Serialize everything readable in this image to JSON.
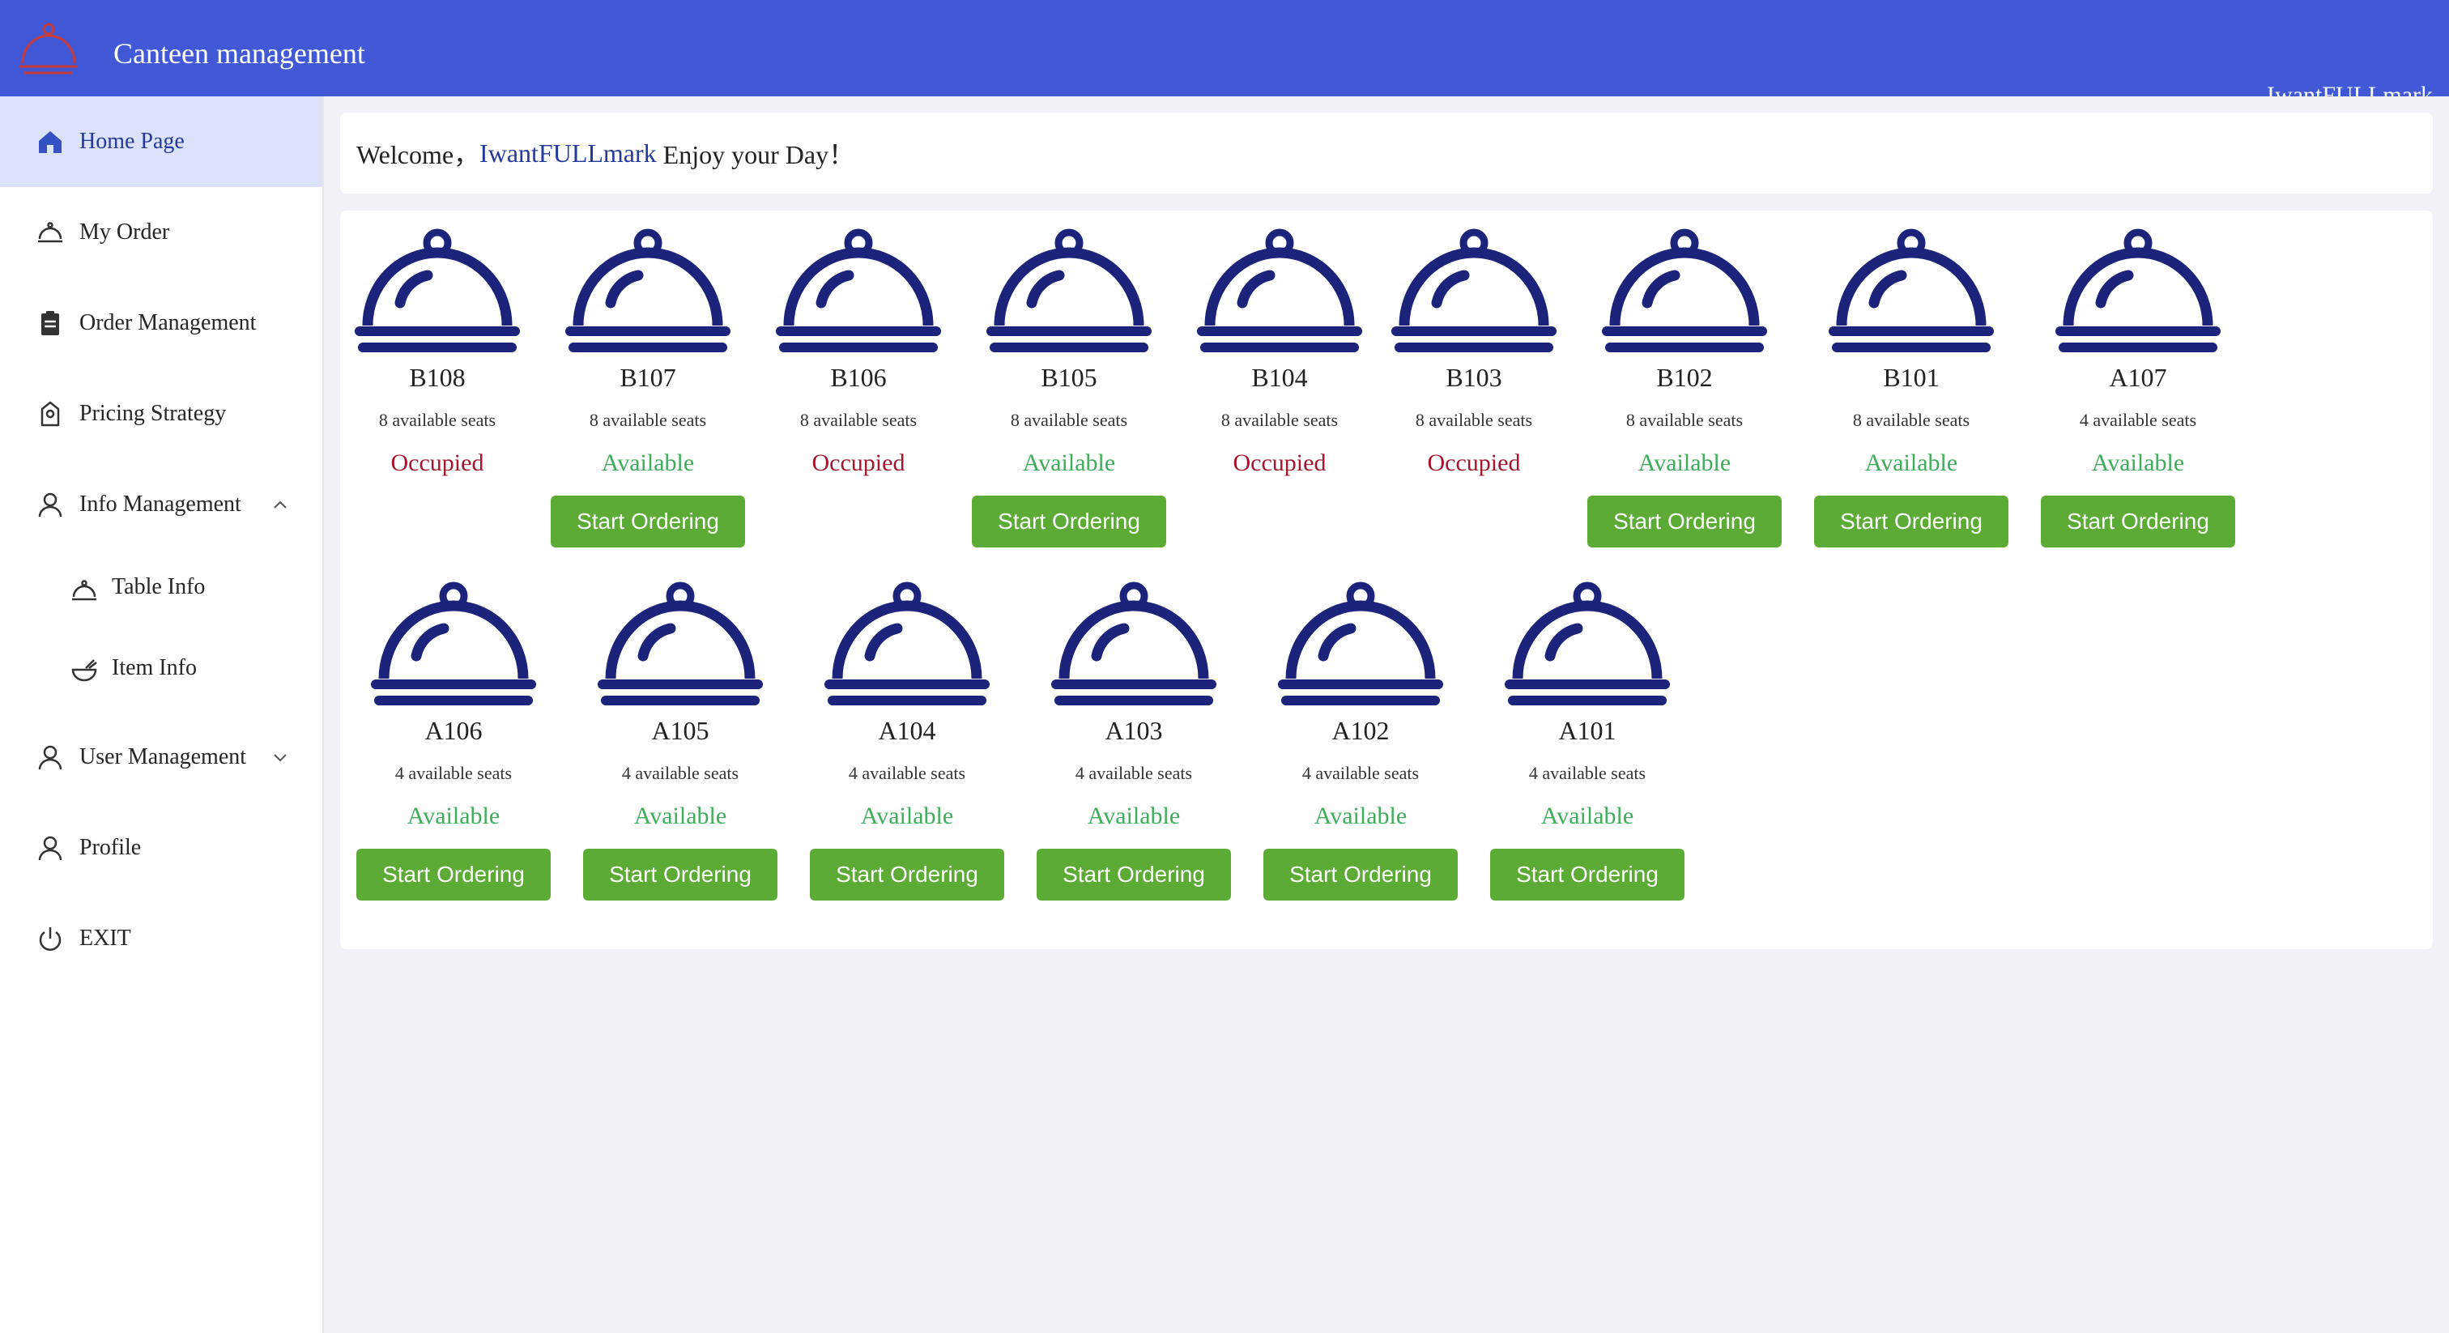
{
  "header": {
    "title": "Canteen management",
    "user": "IwantFULLmark"
  },
  "sidebar": {
    "items": [
      {
        "label": "Home Page",
        "icon": "home-icon",
        "active": true
      },
      {
        "label": "My Order",
        "icon": "cloche-icon"
      },
      {
        "label": "Order Management",
        "icon": "clipboard-icon"
      },
      {
        "label": "Pricing Strategy",
        "icon": "price-tag-icon"
      },
      {
        "label": "Info Management",
        "icon": "user-icon",
        "expanded": true
      },
      {
        "label": "User Management",
        "icon": "user-icon"
      },
      {
        "label": "Profile",
        "icon": "user-icon"
      },
      {
        "label": "EXIT",
        "icon": "power-icon"
      }
    ],
    "subitems": [
      {
        "label": "Table Info",
        "icon": "cloche-icon"
      },
      {
        "label": "Item Info",
        "icon": "bowl-icon"
      }
    ]
  },
  "welcome": {
    "prefix": "Welcome，",
    "name": "IwantFULLmark",
    "suffix": " Enjoy your Day！"
  },
  "tables": [
    {
      "name": "B108",
      "seats": "8 available seats",
      "status": "Occupied",
      "button": ""
    },
    {
      "name": "B107",
      "seats": "8 available seats",
      "status": "Available",
      "button": "Start Ordering"
    },
    {
      "name": "B106",
      "seats": "8 available seats",
      "status": "Occupied",
      "button": ""
    },
    {
      "name": "B105",
      "seats": "8 available seats",
      "status": "Available",
      "button": "Start Ordering"
    },
    {
      "name": "B104",
      "seats": "8 available seats",
      "status": "Occupied",
      "button": ""
    },
    {
      "name": "B103",
      "seats": "8 available seats",
      "status": "Occupied",
      "button": ""
    },
    {
      "name": "B102",
      "seats": "8 available seats",
      "status": "Available",
      "button": "Start Ordering"
    },
    {
      "name": "B101",
      "seats": "8 available seats",
      "status": "Available",
      "button": "Start Ordering"
    },
    {
      "name": "A107",
      "seats": "4 available seats",
      "status": "Available",
      "button": "Start Ordering"
    },
    {
      "name": "A106",
      "seats": "4 available seats",
      "status": "Available",
      "button": "Start Ordering"
    },
    {
      "name": "A105",
      "seats": "4 available seats",
      "status": "Available",
      "button": "Start Ordering"
    },
    {
      "name": "A104",
      "seats": "4 available seats",
      "status": "Available",
      "button": "Start Ordering"
    },
    {
      "name": "A103",
      "seats": "4 available seats",
      "status": "Available",
      "button": "Start Ordering"
    },
    {
      "name": "A102",
      "seats": "4 available seats",
      "status": "Available",
      "button": "Start Ordering"
    },
    {
      "name": "A101",
      "seats": "4 available seats",
      "status": "Available",
      "button": "Start Ordering"
    }
  ],
  "colors": {
    "header": "#4159d6",
    "active_nav": "#dbe2fa",
    "available": "#3dae5a",
    "occupied": "#a3162e",
    "button": "#5bab35",
    "cloche": "#1b237a"
  }
}
